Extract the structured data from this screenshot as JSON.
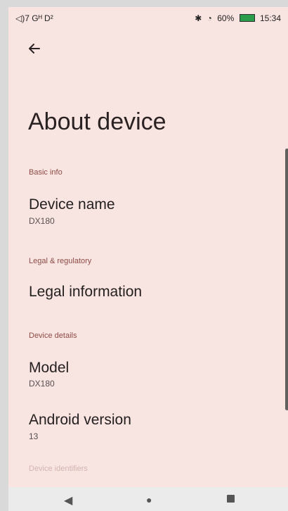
{
  "status_bar": {
    "left": "◁)7 Gᴴ D²",
    "bluetooth": "✱",
    "signal": "ᐧ",
    "wifi": "◔",
    "battery_percent": "60%",
    "time": "15:34"
  },
  "header": {
    "back_icon": "←",
    "title": "About device"
  },
  "sections": [
    {
      "heading": "Basic info",
      "items": [
        {
          "title": "Device name",
          "subtitle": "DX180"
        }
      ]
    },
    {
      "heading": "Legal & regulatory",
      "items": [
        {
          "title": "Legal information"
        }
      ]
    },
    {
      "heading": "Device details",
      "items": [
        {
          "title": "Model",
          "subtitle": "DX180"
        },
        {
          "title": "Android version",
          "subtitle": "13"
        }
      ]
    }
  ],
  "cutoff_heading": "Device identifiers",
  "navbar": {
    "back": "◀",
    "home": "●"
  }
}
